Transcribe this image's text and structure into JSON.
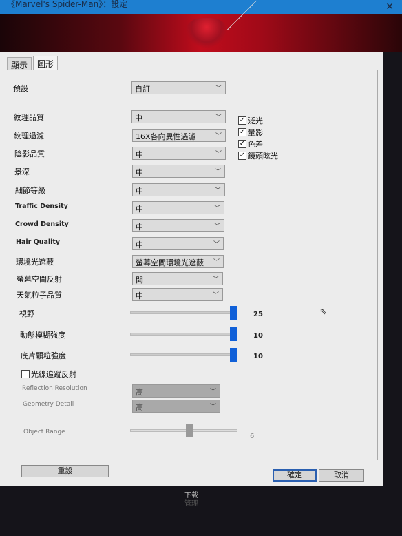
{
  "window": {
    "title": "《Marvel's Spider-Man》：設定",
    "close_icon": "close-icon"
  },
  "tabs": [
    {
      "label": "顯示",
      "active": false
    },
    {
      "label": "圖形",
      "active": true
    }
  ],
  "preset": {
    "label": "預設",
    "value": "自訂"
  },
  "settings": [
    {
      "label": "紋理品質",
      "value": "中"
    },
    {
      "label": "紋理過濾",
      "value": "16X各向異性過濾"
    },
    {
      "label": "陰影品質",
      "value": "中"
    },
    {
      "label": "景深",
      "value": "中"
    },
    {
      "label": "細節等級",
      "value": "中"
    },
    {
      "label": "Traffic Density",
      "value": "中"
    },
    {
      "label": "Crowd Density",
      "value": "中"
    },
    {
      "label": "Hair Quality",
      "value": "中"
    },
    {
      "label": "環境光遮蔽",
      "value": "螢幕空間環境光遮蔽"
    },
    {
      "label": "螢幕空間反射",
      "value": "開"
    },
    {
      "label": "天氣粒子品質",
      "value": "中"
    }
  ],
  "effects": [
    {
      "label": "泛光",
      "checked": true
    },
    {
      "label": "暈影",
      "checked": true
    },
    {
      "label": "色差",
      "checked": true
    },
    {
      "label": "鏡頭眩光",
      "checked": true
    }
  ],
  "sliders": [
    {
      "label": "視野",
      "value": "25",
      "fraction": 1.0
    },
    {
      "label": "動態模糊強度",
      "value": "10",
      "fraction": 1.0
    },
    {
      "label": "底片顆粒強度",
      "value": "10",
      "fraction": 1.0
    }
  ],
  "raytracing": {
    "label": "光線追蹤反射",
    "checked": false,
    "reflection_resolution": {
      "label": "Reflection Resolution",
      "value": "高"
    },
    "geometry_detail": {
      "label": "Geometry Detail",
      "value": "高"
    },
    "object_range": {
      "label": "Object Range",
      "value": "6",
      "fraction": 0.55
    }
  },
  "buttons": {
    "reset": "重設",
    "ok": "確定",
    "cancel": "取消"
  },
  "background": {
    "download": "下载",
    "manage": "管理"
  },
  "colors": {
    "accent": "#1060d8",
    "titlebar": "#1e7fd0"
  }
}
